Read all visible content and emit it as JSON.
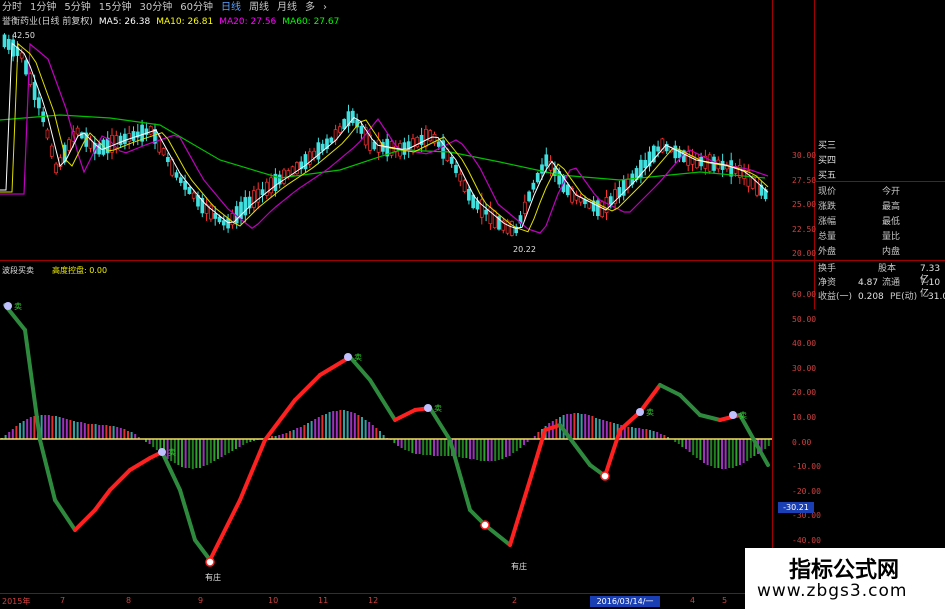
{
  "toolbar": {
    "tabs": [
      "分时",
      "1分钟",
      "5分钟",
      "15分钟",
      "30分钟",
      "60分钟",
      "日线",
      "周线",
      "月线",
      "多",
      "›"
    ],
    "active_index": 6
  },
  "title": {
    "stock": "誉衡药业(日线 前复权)",
    "ma5": "MA5: 26.38",
    "ma10": "MA10: 26.81",
    "ma20": "MA20: 27.56",
    "ma60": "MA60: 27.67",
    "colors": {
      "ma5": "#ffffff",
      "ma10": "#ffff00",
      "ma20": "#ff00ff",
      "ma60": "#00ff00"
    }
  },
  "price_chart": {
    "high_label": "42.50",
    "low_label": "20.22",
    "yticks": [
      "30.00",
      "27.50",
      "25.00",
      "22.50",
      "20.00"
    ]
  },
  "indicator": {
    "name": "波段买卖",
    "sub": "高度控盘: 0.00",
    "yticks": [
      "60.00",
      "50.00",
      "40.00",
      "30.00",
      "20.00",
      "10.00",
      "0.00",
      "-10.00",
      "-20.00",
      "-30.00",
      "-40.00",
      "-50.00"
    ],
    "current_value": "-30.21",
    "sell_label": "卖",
    "buy_label": "买",
    "press_label": "有庄"
  },
  "right_panel": {
    "orders": [
      "买三",
      "买四",
      "买五"
    ],
    "quote_left": [
      "现价",
      "涨跌",
      "涨幅",
      "总量",
      "外盘"
    ],
    "quote_right": [
      "今开",
      "最高",
      "最低",
      "量比",
      "内盘"
    ],
    "stats": [
      {
        "k1": "换手",
        "v1": "",
        "k2": "股本",
        "v2": "7.33亿"
      },
      {
        "k1": "净资",
        "v1": "4.87",
        "k2": "流通",
        "v2": "7.10亿"
      },
      {
        "k1": "收益(一)",
        "v1": "0.208",
        "k2": "PE(动)",
        "v2": "31.0"
      }
    ]
  },
  "date_axis": {
    "labels": [
      "2015年",
      "7",
      "8",
      "9",
      "10",
      "11",
      "12",
      "2",
      "4",
      "5"
    ],
    "cursor_date": "2016/03/14/一"
  },
  "watermark": {
    "line1": "指标公式网",
    "line2": "www.zbgs3.com"
  }
}
